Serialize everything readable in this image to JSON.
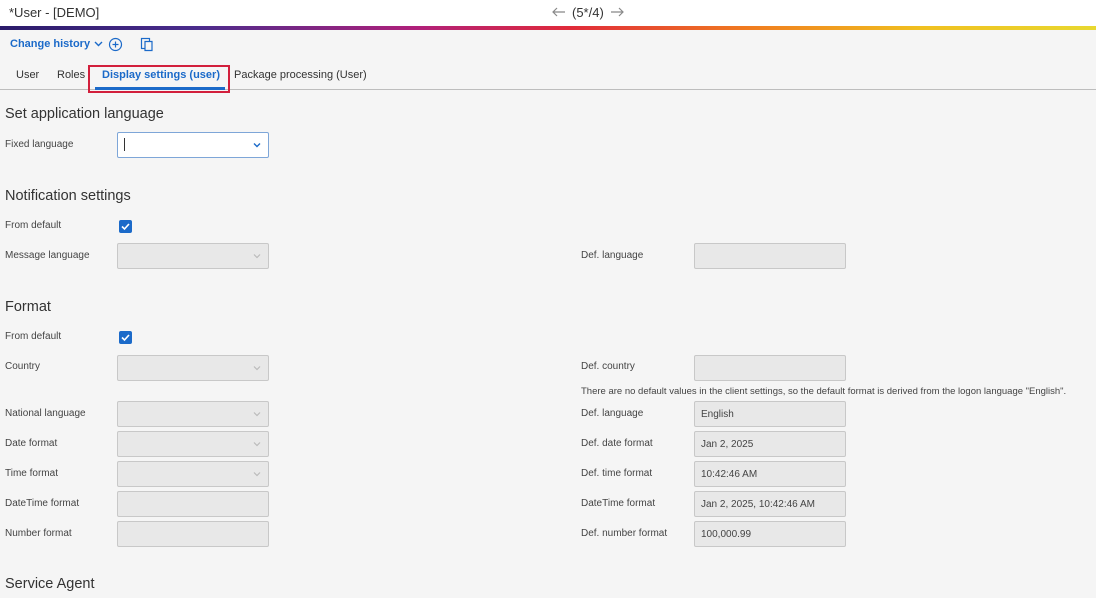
{
  "window": {
    "title": "*User - [DEMO]",
    "nav_position": "(5*/4)",
    "prev_icon": "arrow-left-icon",
    "next_icon": "arrow-right-icon"
  },
  "toolbar": {
    "history_label": "Change history",
    "add_icon": "plus-circle-icon",
    "copy_icon": "copy-icon"
  },
  "tabs": [
    {
      "label": "User",
      "active": false
    },
    {
      "label": "Roles",
      "active": false
    },
    {
      "label": "Display settings (user)",
      "active": true
    },
    {
      "label": "Package processing (User)",
      "active": false
    }
  ],
  "sections": {
    "app_language": {
      "heading": "Set application language",
      "fixed_language_label": "Fixed language",
      "fixed_language_value": ""
    },
    "notification": {
      "heading": "Notification settings",
      "from_default_label": "From default",
      "from_default_checked": true,
      "message_language_label": "Message language",
      "message_language_value": "",
      "def_language_label": "Def. language",
      "def_language_value": ""
    },
    "format": {
      "heading": "Format",
      "from_default_label": "From default",
      "from_default_checked": true,
      "country_label": "Country",
      "country_value": "",
      "def_country_label": "Def. country",
      "def_country_value": "",
      "note": "There are no default values in the client settings, so the default format is derived from the logon language \"English\".",
      "national_language_label": "National language",
      "national_language_value": "",
      "def_language_label": "Def. language",
      "def_language_value": "English",
      "date_format_label": "Date format",
      "date_format_value": "",
      "def_date_format_label": "Def. date format",
      "def_date_format_value": "Jan 2, 2025",
      "time_format_label": "Time format",
      "time_format_value": "",
      "def_time_format_label": "Def. time format",
      "def_time_format_value": "10:42:46 AM",
      "datetime_format_label": "DateTime format",
      "datetime_format_value": "",
      "def_datetime_format_label": "DateTime format",
      "def_datetime_format_value": "Jan 2, 2025, 10:42:46 AM",
      "number_format_label": "Number format",
      "number_format_value": "",
      "def_number_format_label": "Def. number format",
      "def_number_format_value": "100,000.99"
    },
    "service_agent": {
      "heading": "Service Agent"
    }
  },
  "colors": {
    "accent": "#1b6ac9",
    "highlight_box": "#d21f3c"
  }
}
